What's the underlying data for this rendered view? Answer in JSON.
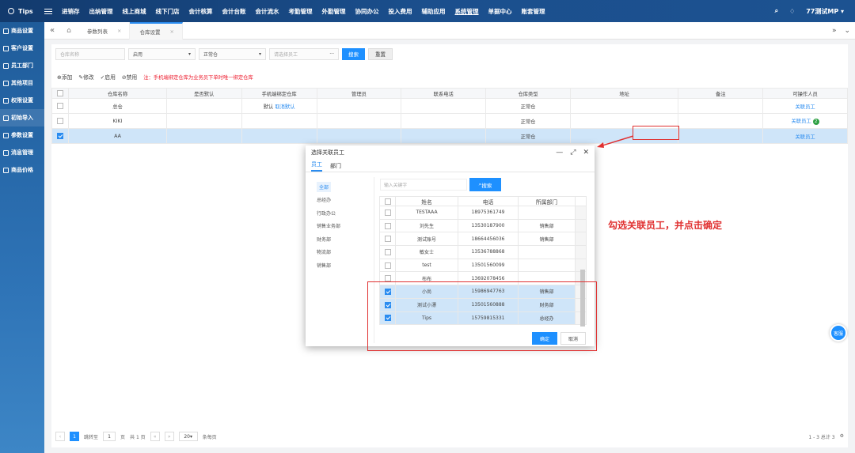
{
  "topbar": {
    "brand": "Tips",
    "nav": [
      "进销存",
      "出纳管理",
      "线上商城",
      "线下门店",
      "会计核算",
      "会计台账",
      "会计流水",
      "考勤管理",
      "外勤管理",
      "协同办公",
      "投入费用",
      "辅助应用",
      "系统管理",
      "单据中心",
      "账套管理"
    ],
    "active_nav": "系统管理",
    "user": "77测试MP ▾"
  },
  "sidebar": {
    "items": [
      "商品设置",
      "客户设置",
      "员工部门",
      "其他项目",
      "权限设置",
      "初始导入",
      "参数设置",
      "消息管理",
      "商品价格"
    ],
    "active": "初始导入"
  },
  "tabs": {
    "items": [
      "参数列表",
      "仓库设置"
    ],
    "active": "仓库设置"
  },
  "filters": {
    "warehouse_placeholder": "仓库名称",
    "status_value": "启用",
    "type_value": "正常仓",
    "employee_placeholder": "请选择员工",
    "ellipsis": "···",
    "search_label": "搜索",
    "reset_label": "重置"
  },
  "toolbar": {
    "add": "添加",
    "edit": "修改",
    "enable": "启用",
    "disable": "禁用",
    "note": "注：手机端绑定仓库为业务员下单时唯一绑定仓库"
  },
  "grid": {
    "columns": [
      "",
      "仓库名称",
      "是否默认",
      "手机端绑定仓库",
      "管理员",
      "联系电话",
      "仓库类型",
      "地址",
      "备注",
      "可操作人员"
    ],
    "rows": [
      {
        "name": "总仓",
        "default": "",
        "mobile_default": "默认",
        "mobile_cancel": "取消默认",
        "admin": "",
        "phone": "",
        "type": "正常仓",
        "address": "",
        "remark": "",
        "staff": "关联员工",
        "badge": "",
        "selected": false
      },
      {
        "name": "KIKI",
        "default": "",
        "mobile_default": "",
        "mobile_cancel": "",
        "admin": "",
        "phone": "",
        "type": "正常仓",
        "address": "",
        "remark": "",
        "staff": "关联员工",
        "badge": "2",
        "selected": false
      },
      {
        "name": "AA",
        "default": "",
        "mobile_default": "",
        "mobile_cancel": "",
        "admin": "",
        "phone": "",
        "type": "正常仓",
        "address": "",
        "remark": "",
        "staff": "关联员工",
        "badge": "",
        "selected": true
      }
    ]
  },
  "pager": {
    "current": "1",
    "goto_label": "跳转至",
    "goto_value": "1",
    "page_unit": "页",
    "total_pages": "共 1 页",
    "page_size": "20",
    "per_page": "条每页",
    "summary": "1 - 3 总计 3"
  },
  "dialog": {
    "title": "选择关联员工",
    "tabs": [
      "员工",
      "部门"
    ],
    "active_tab": "员工",
    "departments": [
      "全部",
      "总经办",
      "行政办公",
      "销售业务部",
      "财务部",
      "物流部",
      "销售部"
    ],
    "active_department": "全部",
    "search_placeholder": "输入关键字",
    "search_label": "搜索",
    "columns": [
      "",
      "姓名",
      "电话",
      "所属部门"
    ],
    "rows": [
      {
        "name": "TESTAAA",
        "phone": "18975361749",
        "dept": "",
        "checked": false
      },
      {
        "name": "刘先生",
        "phone": "13530187900",
        "dept": "销售部",
        "checked": false
      },
      {
        "name": "测试账号",
        "phone": "18664456036",
        "dept": "销售部",
        "checked": false
      },
      {
        "name": "敏女士",
        "phone": "13536788868",
        "dept": "",
        "checked": false
      },
      {
        "name": "test",
        "phone": "13501560099",
        "dept": "",
        "checked": false
      },
      {
        "name": "布布",
        "phone": "13692078456",
        "dept": "",
        "checked": false
      },
      {
        "name": "小尚",
        "phone": "15986947763",
        "dept": "销售部",
        "checked": true
      },
      {
        "name": "测试小漂",
        "phone": "13501560888",
        "dept": "财务部",
        "checked": true
      },
      {
        "name": "Tips",
        "phone": "15759815331",
        "dept": "总经办",
        "checked": true
      }
    ],
    "ok_label": "确定",
    "cancel_label": "取消"
  },
  "annotation": "勾选关联员工，并点击确定",
  "service_label": "客服",
  "colors": {
    "primary": "#1e90ff",
    "annotation": "#e03030",
    "topbar": "#123a6d",
    "sidebar": "#2e73b6"
  }
}
